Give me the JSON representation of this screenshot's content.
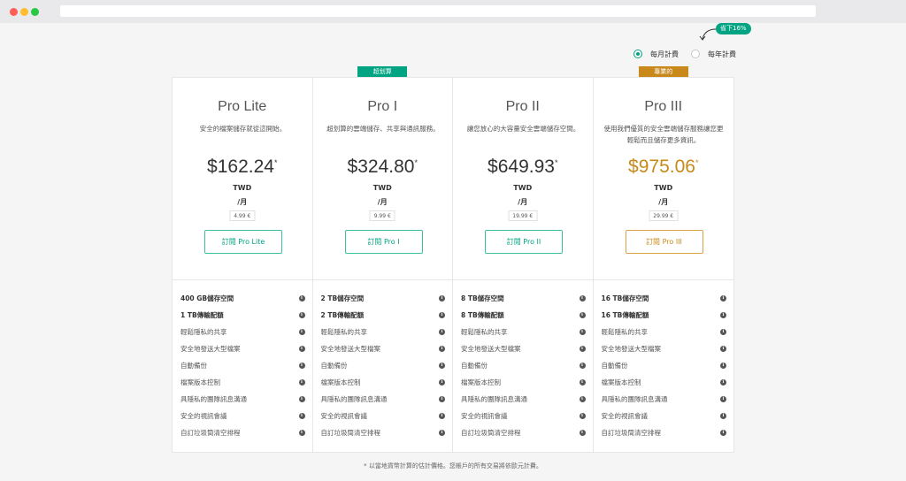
{
  "billing": {
    "monthly_label": "每月計費",
    "yearly_label": "每年計費",
    "save_badge": "省下16%"
  },
  "plans": [
    {
      "name": "Pro Lite",
      "desc": "安全的檔案儲存就從這開始。",
      "price": "$162.24",
      "price_mark": "*",
      "currency": "TWD",
      "period": "/月",
      "eur": "4.99 €",
      "cta": "訂閱 Pro Lite",
      "features": [
        "400 GB儲存空間",
        "1 TB傳輸配額",
        "輕鬆隱私的共享",
        "安全地發送大型檔案",
        "自動備份",
        "檔案版本控制",
        "具隱私的團隊訊息溝通",
        "安全的視訊會議",
        "自訂垃圾筒清空排程"
      ]
    },
    {
      "tag": "超划算",
      "name": "Pro I",
      "desc": "超划算的雲端儲存、共享與通訊服務。",
      "price": "$324.80",
      "price_mark": "*",
      "currency": "TWD",
      "period": "/月",
      "eur": "9.99 €",
      "cta": "訂閱 Pro I",
      "features": [
        "2 TB儲存空間",
        "2 TB傳輸配額",
        "輕鬆隱私的共享",
        "安全地發送大型檔案",
        "自動備份",
        "檔案版本控制",
        "具隱私的團隊訊息溝通",
        "安全的視訊會議",
        "自訂垃圾筒清空排程"
      ]
    },
    {
      "name": "Pro II",
      "desc": "讓您放心的大容量安全雲端儲存空間。",
      "price": "$649.93",
      "price_mark": "*",
      "currency": "TWD",
      "period": "/月",
      "eur": "19.99 €",
      "cta": "訂閱 Pro II",
      "features": [
        "8 TB儲存空間",
        "8 TB傳輸配額",
        "輕鬆隱私的共享",
        "安全地發送大型檔案",
        "自動備份",
        "檔案版本控制",
        "具隱私的團隊訊息溝通",
        "安全的視訊會議",
        "自訂垃圾筒清空排程"
      ]
    },
    {
      "tag": "專業的",
      "name": "Pro III",
      "desc": "使用我們優質的安全雲端儲存服務讓您更輕鬆而且儲存更多資訊。",
      "price": "$975.06",
      "price_mark": "*",
      "currency": "TWD",
      "period": "/月",
      "eur": "29.99 €",
      "cta": "訂閱 Pro III",
      "features": [
        "16 TB儲存空間",
        "16 TB傳輸配額",
        "輕鬆隱私的共享",
        "安全地發送大型檔案",
        "自動備份",
        "檔案版本控制",
        "具隱私的團隊訊息溝通",
        "安全的視訊會議",
        "自訂垃圾筒清空排程"
      ]
    }
  ],
  "info_glyph": "i",
  "footnote": "* 以當地貨幣計算的估計價格。您帳戶的所有交易將依歐元計費。",
  "colors": {
    "accent": "#00a382",
    "gold": "#c8881a"
  },
  "icons": {
    "info": "info-icon",
    "arrow": "curved-arrow-icon"
  }
}
